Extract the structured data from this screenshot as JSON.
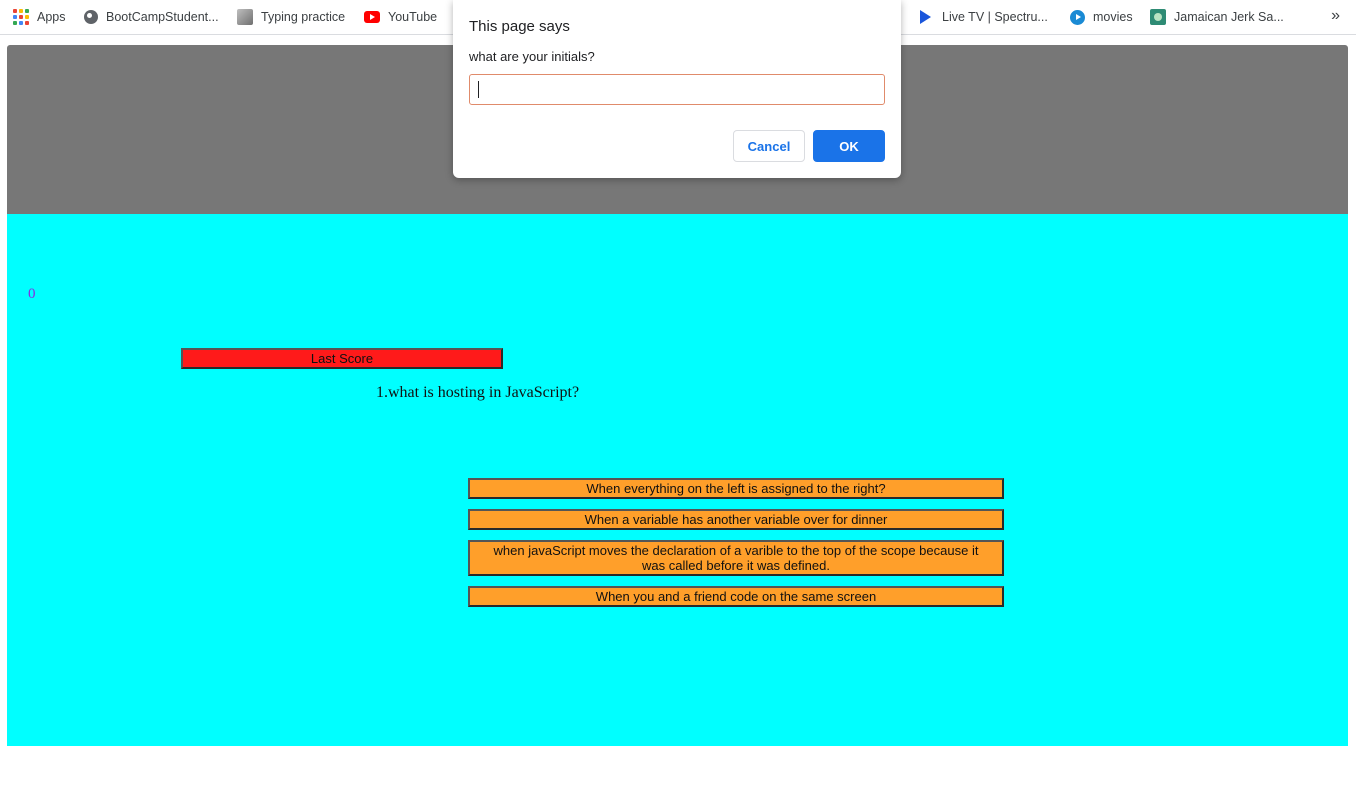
{
  "bookmarks": {
    "items": [
      {
        "label": "Apps",
        "icon": "apps-grid-icon"
      },
      {
        "label": "BootCampStudent...",
        "icon": "globe-icon"
      },
      {
        "label": "Typing practice",
        "icon": "typing-icon"
      },
      {
        "label": "YouTube",
        "icon": "youtube-icon"
      },
      {
        "label": "Live TV | Spectru...",
        "icon": "play-icon"
      },
      {
        "label": "movies",
        "icon": "movies-icon"
      },
      {
        "label": "Jamaican Jerk Sa...",
        "icon": "jerk-icon"
      }
    ],
    "overflow": "»"
  },
  "quiz": {
    "score": "0",
    "last_score_label": "Last Score",
    "question": "1.what is hosting in JavaScript?",
    "answers": [
      "When everything on the left is assigned to the right?",
      "When a variable has another variable over for dinner",
      "when javaScript moves the declaration of a varible to the top of the scope because it was called before it was defined.",
      "When you and a friend code on the same screen"
    ]
  },
  "dialog": {
    "title": "This page says",
    "message": "what are your initials?",
    "input_value": "",
    "cancel_label": "Cancel",
    "ok_label": "OK"
  },
  "colors": {
    "header_band": "#777777",
    "quiz_background": "#00ffff",
    "last_score_button": "#ff1a1a",
    "answer_button": "#ff9f2a",
    "ok_button": "#1a73e8",
    "score_text": "#8a2be2"
  }
}
